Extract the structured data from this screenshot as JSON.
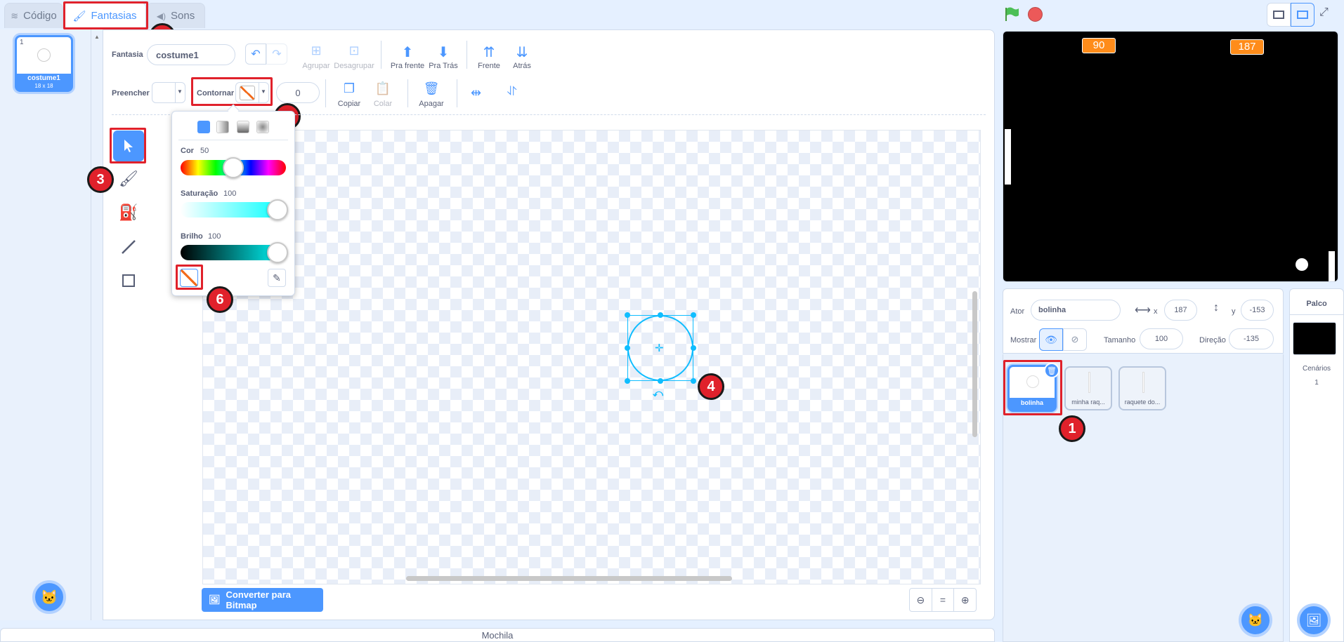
{
  "tabs": {
    "code": "Código",
    "costumes": "Fantasias",
    "sounds": "Sons"
  },
  "costume_list": [
    {
      "number": "1",
      "name": "costume1",
      "size": "18 x 18"
    }
  ],
  "toolbar": {
    "costume_label": "Fantasia",
    "costume_name": "costume1",
    "group": "Agrupar",
    "ungroup": "Desagrupar",
    "forward": "Pra frente",
    "backward": "Pra Trás",
    "front": "Frente",
    "back": "Atrás",
    "fill_label": "Preencher",
    "outline_label": "Contornar",
    "outline_width": "0",
    "copy": "Copiar",
    "paste": "Colar",
    "delete": "Apagar"
  },
  "color_picker": {
    "color_label": "Cor",
    "color_value": "50",
    "saturation_label": "Saturação",
    "saturation_value": "100",
    "brightness_label": "Brilho",
    "brightness_value": "100"
  },
  "convert_button": "Converter para Bitmap",
  "zoom": {
    "out": "−",
    "reset": "=",
    "in": "+"
  },
  "backpack": "Mochila",
  "stage": {
    "monitor_left": "90",
    "monitor_right": "187",
    "background": "#000000"
  },
  "sprite_info": {
    "sprite_label": "Ator",
    "sprite_name": "bolinha",
    "x_label": "x",
    "x_value": "187",
    "y_label": "y",
    "y_value": "-153",
    "show_label": "Mostrar",
    "size_label": "Tamanho",
    "size_value": "100",
    "direction_label": "Direção",
    "direction_value": "-135"
  },
  "sprites": [
    {
      "name": "bolinha"
    },
    {
      "name": "minha raq..."
    },
    {
      "name": "raquete do..."
    }
  ],
  "stage_panel": {
    "title": "Palco",
    "backdrops_label": "Cenários",
    "backdrops_count": "1"
  },
  "badges": [
    "1",
    "2",
    "3",
    "4",
    "5",
    "6"
  ],
  "colors": {
    "accent": "#4c97ff",
    "highlight": "#e0212b",
    "selection": "#0fbdff"
  }
}
